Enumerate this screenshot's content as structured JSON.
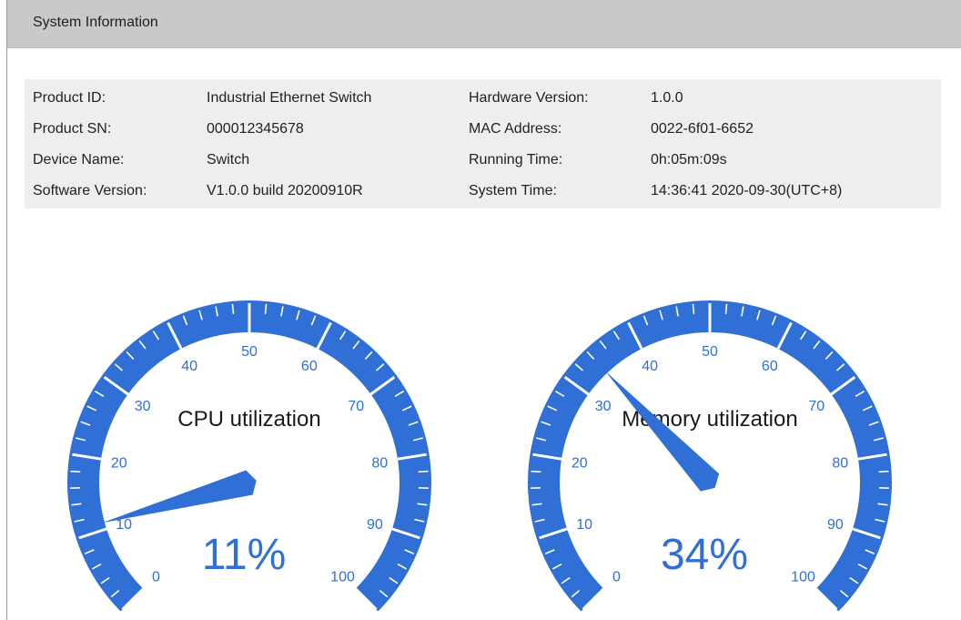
{
  "header": {
    "title": "System Information"
  },
  "info": {
    "rows": [
      {
        "label1": "Product ID:",
        "value1": "Industrial Ethernet Switch",
        "label2": "Hardware Version:",
        "value2": "1.0.0"
      },
      {
        "label1": "Product SN:",
        "value1": "000012345678",
        "label2": "MAC Address:",
        "value2": "0022-6f01-6652"
      },
      {
        "label1": "Device Name:",
        "value1": "Switch",
        "label2": "Running Time:",
        "value2": "0h:05m:09s"
      },
      {
        "label1": "Software Version:",
        "value1": "V1.0.0 build 20200910R",
        "label2": "System Time:",
        "value2": "14:36:41 2020-09-30(UTC+8)"
      }
    ]
  },
  "gauges": [
    {
      "title": "CPU utilization",
      "value_text": "11%",
      "value": 11,
      "min": 0,
      "max": 100,
      "tick_labels": [
        "0",
        "10",
        "20",
        "30",
        "40",
        "50",
        "60",
        "70",
        "80",
        "90",
        "100"
      ]
    },
    {
      "title": "Memory utilization",
      "value_text": "34%",
      "value": 34,
      "min": 0,
      "max": 100,
      "tick_labels": [
        "0",
        "10",
        "20",
        "30",
        "40",
        "50",
        "60",
        "70",
        "80",
        "90",
        "100"
      ]
    }
  ],
  "colors": {
    "accent": "#2f6fd6",
    "header_bg": "#c9c9c9",
    "panel_bg": "#eeeeee"
  }
}
